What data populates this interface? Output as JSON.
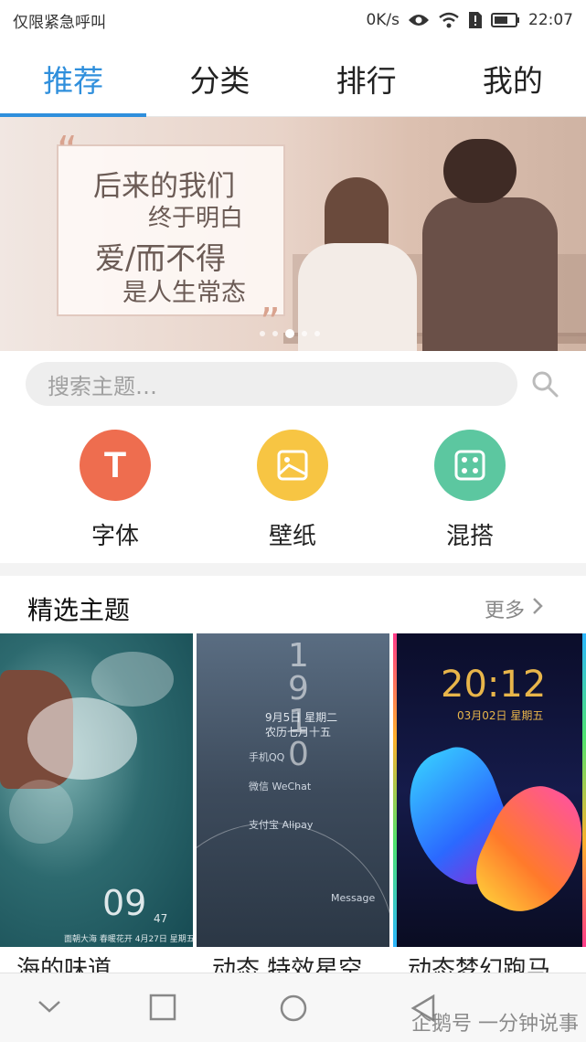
{
  "status": {
    "left_text": "仅限紧急呼叫",
    "speed": "0K/s",
    "time": "22:07"
  },
  "tabs": [
    {
      "label": "推荐",
      "active": true
    },
    {
      "label": "分类",
      "active": false
    },
    {
      "label": "排行",
      "active": false
    },
    {
      "label": "我的",
      "active": false
    }
  ],
  "banner": {
    "lines": [
      "后来的我们",
      "终于明白",
      "爱/而不得",
      "是人生常态"
    ],
    "page_count": 5,
    "active_index": 2
  },
  "search": {
    "placeholder": "搜索主题…"
  },
  "categories": [
    {
      "label": "字体",
      "icon": "font-icon",
      "color": "#ee6d4f",
      "glyph": "T"
    },
    {
      "label": "壁纸",
      "icon": "image-icon",
      "color": "#f7c543"
    },
    {
      "label": "混搭",
      "icon": "dice-icon",
      "color": "#5cc7a0"
    }
  ],
  "section": {
    "title": "精选主题",
    "more": "更多"
  },
  "themes": [
    {
      "name": "海的味道",
      "clock": "09",
      "seconds": "47",
      "date": "面朝大海 春暖花开 4月27日 星期五"
    },
    {
      "name": "动态 特效星空",
      "time": "19 10",
      "date": "9月5日 星期二",
      "lunar": "农历七月十五",
      "rows": [
        "手机QQ",
        "微信 WeChat",
        "支付宝 Alipay",
        "Message"
      ]
    },
    {
      "name": "动态梦幻跑马",
      "clock": "20:12",
      "date": "03月02日 星期五"
    }
  ],
  "watermark": "企鹅号 一分钟说事",
  "colors": {
    "accent": "#2f8fdc"
  }
}
